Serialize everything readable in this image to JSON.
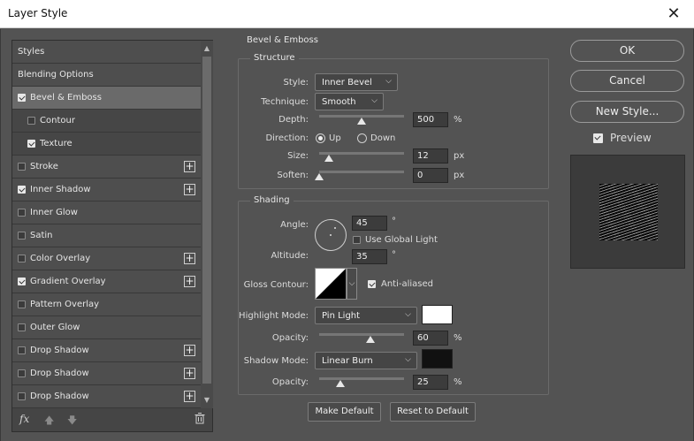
{
  "window": {
    "title": "Layer Style",
    "close_glyph": "✕"
  },
  "sidebar": {
    "items": [
      {
        "label": "Styles",
        "checkbox": false,
        "checked": false,
        "plus": false,
        "selected": false,
        "sub": false
      },
      {
        "label": "Blending Options",
        "checkbox": false,
        "checked": false,
        "plus": false,
        "selected": false,
        "sub": false
      },
      {
        "label": "Bevel & Emboss",
        "checkbox": true,
        "checked": true,
        "plus": false,
        "selected": true,
        "sub": false
      },
      {
        "label": "Contour",
        "checkbox": true,
        "checked": false,
        "plus": false,
        "selected": false,
        "sub": true
      },
      {
        "label": "Texture",
        "checkbox": true,
        "checked": true,
        "plus": false,
        "selected": false,
        "sub": true
      },
      {
        "label": "Stroke",
        "checkbox": true,
        "checked": false,
        "plus": true,
        "selected": false,
        "sub": false
      },
      {
        "label": "Inner Shadow",
        "checkbox": true,
        "checked": true,
        "plus": true,
        "selected": false,
        "sub": false
      },
      {
        "label": "Inner Glow",
        "checkbox": true,
        "checked": false,
        "plus": false,
        "selected": false,
        "sub": false
      },
      {
        "label": "Satin",
        "checkbox": true,
        "checked": false,
        "plus": false,
        "selected": false,
        "sub": false
      },
      {
        "label": "Color Overlay",
        "checkbox": true,
        "checked": false,
        "plus": true,
        "selected": false,
        "sub": false
      },
      {
        "label": "Gradient Overlay",
        "checkbox": true,
        "checked": true,
        "plus": true,
        "selected": false,
        "sub": false
      },
      {
        "label": "Pattern Overlay",
        "checkbox": true,
        "checked": false,
        "plus": false,
        "selected": false,
        "sub": false
      },
      {
        "label": "Outer Glow",
        "checkbox": true,
        "checked": false,
        "plus": false,
        "selected": false,
        "sub": false
      },
      {
        "label": "Drop Shadow",
        "checkbox": true,
        "checked": false,
        "plus": true,
        "selected": false,
        "sub": false
      },
      {
        "label": "Drop Shadow",
        "checkbox": true,
        "checked": false,
        "plus": true,
        "selected": false,
        "sub": false
      },
      {
        "label": "Drop Shadow",
        "checkbox": true,
        "checked": false,
        "plus": true,
        "selected": false,
        "sub": false
      }
    ],
    "footer": {
      "fx_label": "fx",
      "icons": [
        "move-up-icon",
        "move-down-icon",
        "trash-icon"
      ]
    }
  },
  "bevel": {
    "section_title": "Bevel & Emboss",
    "structure": {
      "title": "Structure",
      "style_label": "Style:",
      "style_value": "Inner Bevel",
      "technique_label": "Technique:",
      "technique_value": "Smooth",
      "depth_label": "Depth:",
      "depth_value": "500",
      "depth_unit": "%",
      "depth_slider": 0.5,
      "direction_label": "Direction:",
      "direction_up": "Up",
      "direction_down": "Down",
      "direction_selected": "Up",
      "size_label": "Size:",
      "size_value": "12",
      "size_unit": "px",
      "size_slider": 0.1,
      "soften_label": "Soften:",
      "soften_value": "0",
      "soften_unit": "px",
      "soften_slider": 0.0
    },
    "shading": {
      "title": "Shading",
      "angle_label": "Angle:",
      "angle_value": "45",
      "angle_unit": "°",
      "use_global_light": "Use Global Light",
      "use_global_light_checked": false,
      "altitude_label": "Altitude:",
      "altitude_value": "35",
      "altitude_unit": "°",
      "gloss_contour_label": "Gloss Contour:",
      "anti_aliased": "Anti-aliased",
      "anti_aliased_checked": true,
      "highlight_mode_label": "Highlight Mode:",
      "highlight_mode_value": "Pin Light",
      "highlight_color": "#ffffff",
      "highlight_opacity_label": "Opacity:",
      "highlight_opacity_value": "60",
      "highlight_opacity_unit": "%",
      "highlight_opacity_slider": 0.6,
      "shadow_mode_label": "Shadow Mode:",
      "shadow_mode_value": "Linear Burn",
      "shadow_color": "#111111",
      "shadow_opacity_label": "Opacity:",
      "shadow_opacity_value": "25",
      "shadow_opacity_unit": "%",
      "shadow_opacity_slider": 0.25
    },
    "make_default": "Make Default",
    "reset_default": "Reset to Default"
  },
  "actions": {
    "ok": "OK",
    "cancel": "Cancel",
    "new_style": "New Style...",
    "preview_label": "Preview",
    "preview_checked": true
  }
}
